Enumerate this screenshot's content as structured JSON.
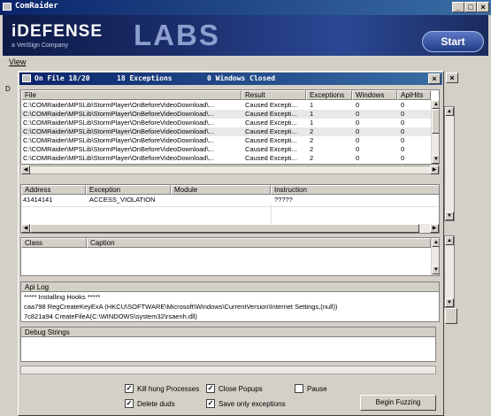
{
  "main_window": {
    "title": "ComRaider"
  },
  "banner": {
    "brand": "iDEFENSE",
    "brand_sub": "a VeriSign Company",
    "labs": "LABS",
    "start_label": "Start"
  },
  "menu": {
    "view": "View"
  },
  "inner_window": {
    "title_file": "On File 18/20",
    "title_exceptions": "18 Exceptions",
    "title_windows": "0 Windows Closed"
  },
  "file_table": {
    "columns": [
      "File",
      "Result",
      "Exceptions",
      "Windows",
      "ApiHits"
    ],
    "rows": [
      [
        "C:\\COMRaider\\MPSLib\\StormPlayer\\OnBeforeVideoDownload\\...",
        "Caused Excepti...",
        "1",
        "0",
        "0"
      ],
      [
        "C:\\COMRaider\\MPSLib\\StormPlayer\\OnBeforeVideoDownload\\...",
        "Caused Excepti...",
        "1",
        "0",
        "0"
      ],
      [
        "C:\\COMRaider\\MPSLib\\StormPlayer\\OnBeforeVideoDownload\\...",
        "Caused Excepti...",
        "1",
        "0",
        "0"
      ],
      [
        "C:\\COMRaider\\MPSLib\\StormPlayer\\OnBeforeVideoDownload\\...",
        "Caused Excepti...",
        "2",
        "0",
        "0"
      ],
      [
        "C:\\COMRaider\\MPSLib\\StormPlayer\\OnBeforeVideoDownload\\...",
        "Caused Excepti...",
        "2",
        "0",
        "0"
      ],
      [
        "C:\\COMRaider\\MPSLib\\StormPlayer\\OnBeforeVideoDownload\\...",
        "Caused Excepti...",
        "2",
        "0",
        "0"
      ],
      [
        "C:\\COMRaider\\MPSLib\\StormPlayer\\OnBeforeVideoDownload\\...",
        "Caused Excepti...",
        "2",
        "0",
        "0"
      ]
    ]
  },
  "exception_table": {
    "columns": [
      "Address",
      "Exception",
      "Module",
      "Instruction"
    ],
    "rows": [
      [
        "41414141",
        "ACCESS_VIOLATION",
        "",
        "?????"
      ]
    ]
  },
  "window_table": {
    "columns": [
      "Class",
      "Caption"
    ]
  },
  "api_log": {
    "title": "Api Log",
    "lines": [
      "***** Installing Hooks *****",
      "caa798     RegCreateKeyExA (HKCU\\SOFTWARE\\Microsoft\\Windows\\CurrentVersion\\Internet Settings,(null))",
      "7c821a94     CreateFileA(C:\\WINDOWS\\system32\\rsaenh.dll)"
    ]
  },
  "debug": {
    "title": "Debug Strings"
  },
  "options": {
    "kill_hung": "Kill hung Processes",
    "close_popups": "Close Popups",
    "pause": "Pause",
    "delete_duds": "Delete duds",
    "save_only": "Save only exceptions",
    "begin_label": "Begin Fuzzing",
    "check_mark": "✓"
  }
}
